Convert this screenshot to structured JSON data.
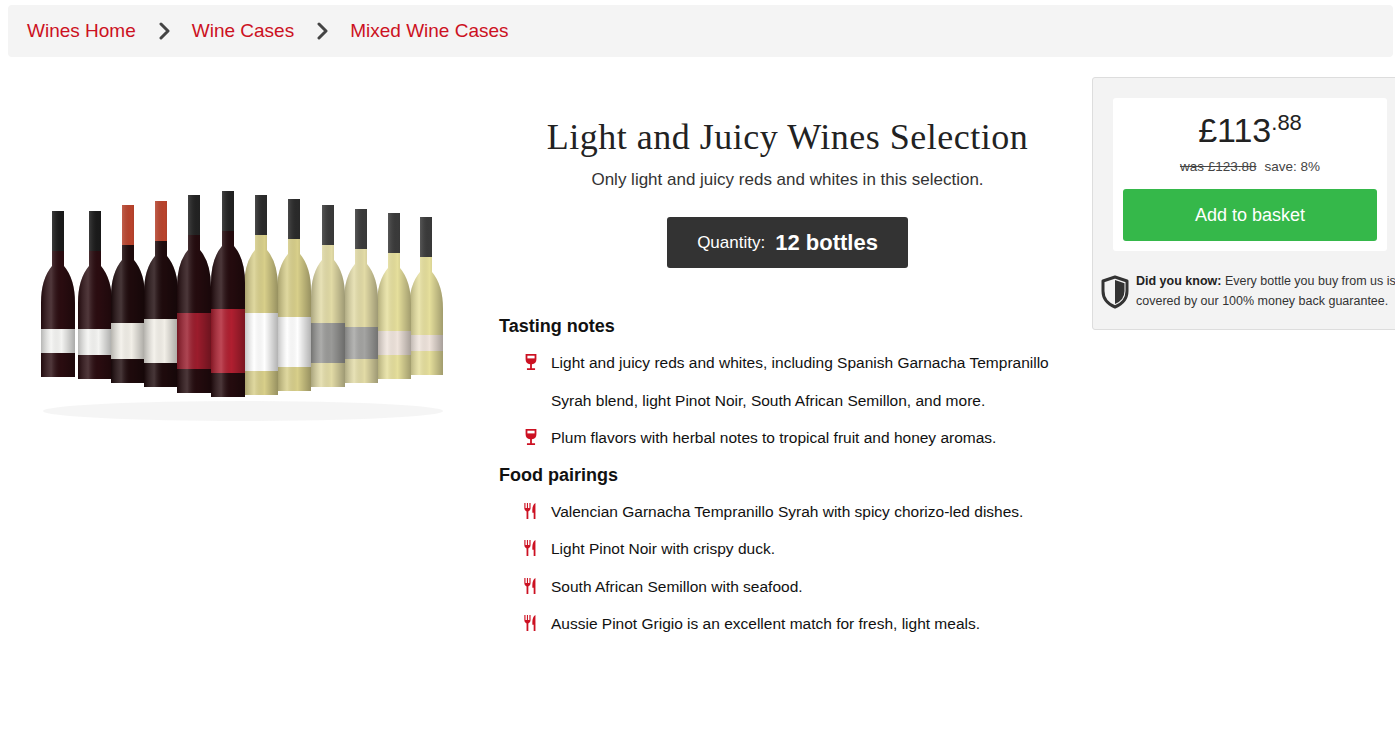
{
  "breadcrumb": [
    {
      "label": "Wines Home"
    },
    {
      "label": "Wine Cases"
    },
    {
      "label": "Mixed Wine Cases"
    }
  ],
  "product": {
    "title": "Light and Juicy Wines Selection",
    "subtitle": "Only light and juicy reds and whites in this selection.",
    "quantity_label": "Quantity:",
    "quantity": "12 bottles"
  },
  "tasting_notes": {
    "heading": "Tasting notes",
    "items": [
      "Light and juicy reds and whites, including Spanish Garnacha Tempranillo Syrah blend, light Pinot Noir, South African Semillon, and more.",
      "Plum flavors with herbal notes to tropical fruit and honey aromas."
    ]
  },
  "food_pairings": {
    "heading": "Food pairings",
    "items": [
      "Valencian Garnacha Tempranillo Syrah with spicy chorizo-led dishes.",
      "Light Pinot Noir with crispy duck.",
      "South African Semillon with seafood.",
      "Aussie Pinot Grigio is an excellent match for fresh, light meals."
    ]
  },
  "price": {
    "pounds": "£113",
    "pence": ".88",
    "was": "was £123.88",
    "save": "save: 8%",
    "button": "Add to basket"
  },
  "guarantee": {
    "bold": "Did you know:",
    "text": "Every bottle you buy from us is covered by our 100% money back guarantee."
  }
}
